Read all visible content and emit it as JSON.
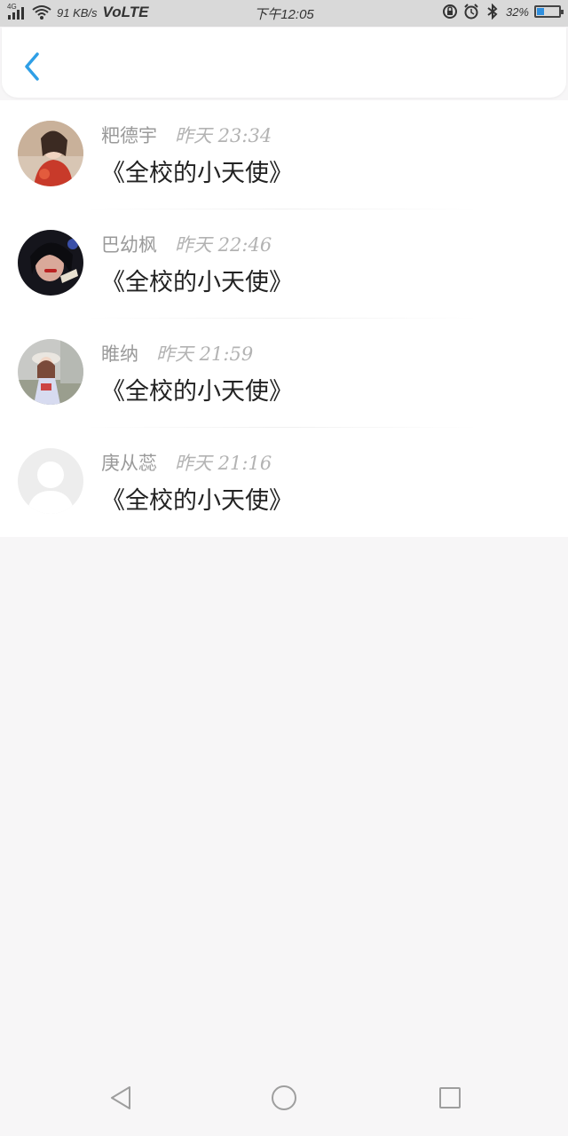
{
  "status_bar": {
    "network": "4G",
    "net_speed": "91 KB/s",
    "volte": "VoLTE",
    "time": "下午12:05",
    "battery": "32%",
    "battery_level": 0.32
  },
  "header": {
    "back_icon": "chevron-left-icon",
    "accent_color": "#2f9fe6"
  },
  "comments": [
    {
      "name": "粑德宇",
      "time": "昨天 23:34",
      "text": "《全校的小天使》",
      "avatar": "photo"
    },
    {
      "name": "巴幼枫",
      "time": "昨天 22:46",
      "text": "《全校的小天使》",
      "avatar": "photo"
    },
    {
      "name": "睢纳",
      "time": "昨天 21:59",
      "text": "《全校的小天使》",
      "avatar": "photo"
    },
    {
      "name": "庚从蕊",
      "time": "昨天 21:16",
      "text": "《全校的小天使》",
      "avatar": "default-avatar"
    }
  ],
  "nav": {
    "back": "triangle-back-icon",
    "home": "circle-home-icon",
    "recents": "square-recents-icon"
  }
}
